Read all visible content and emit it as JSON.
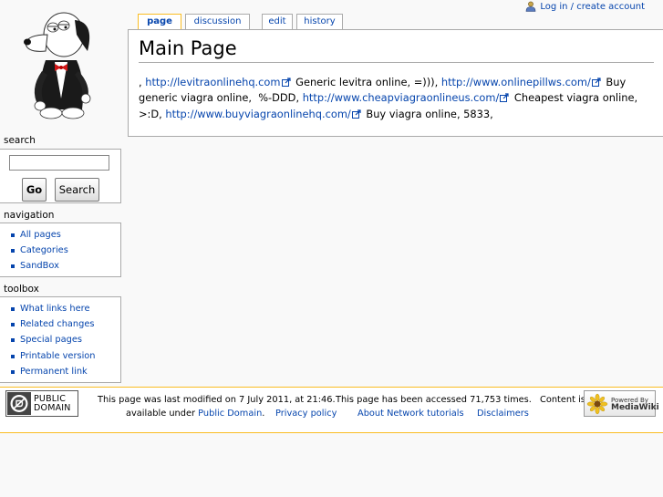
{
  "personal": {
    "login_label": "Log in / create account"
  },
  "tabs": {
    "page": "page",
    "discussion": "discussion",
    "edit": "edit",
    "history": "history"
  },
  "content": {
    "title": "Main Page",
    "body": [
      {
        "t": "text",
        "v": ", "
      },
      {
        "t": "link",
        "v": "http://levitraonlinehq.com"
      },
      {
        "t": "text",
        "v": " Generic levitra online, =))), "
      },
      {
        "t": "link",
        "v": "http://www.onlinepillws.com/"
      },
      {
        "t": "text",
        "v": " Buy generic viagra online,  %-DDD, "
      },
      {
        "t": "link",
        "v": "http://www.cheapviagraonlineus.com/"
      },
      {
        "t": "text",
        "v": " Cheapest viagra online, >:D, "
      },
      {
        "t": "link",
        "v": "http://www.buyviagraonlinehq.com/"
      },
      {
        "t": "text",
        "v": " Buy viagra online, 5833,"
      }
    ]
  },
  "search": {
    "title": "search",
    "go_label": "Go",
    "search_label": "Search",
    "input_value": ""
  },
  "navigation": {
    "title": "navigation",
    "items": [
      "All pages",
      "Categories",
      "SandBox"
    ]
  },
  "toolbox": {
    "title": "toolbox",
    "items": [
      "What links here",
      "Related changes",
      "Special pages",
      "Printable version",
      "Permanent link"
    ]
  },
  "footer": {
    "pd_badge_line1": "PUBLIC",
    "pd_badge_line2": "DOMAIN",
    "last_modified": "This page was last modified on 7 July 2011, at 21:46.",
    "accessed": "This page has been accessed 71,753 times.",
    "content_is": "Content is",
    "available_under": "available under",
    "public_domain_link": "Public Domain",
    "privacy": "Privacy policy",
    "about": "About Network tutorials",
    "disclaimers": "Disclaimers",
    "powered_line1": "Powered By",
    "powered_line2": "MediaWiki"
  },
  "colors": {
    "link": "#0645ad",
    "tab_selected_border": "#fabd23",
    "footer_border": "#fabd23",
    "background": "#f9f9f9"
  }
}
